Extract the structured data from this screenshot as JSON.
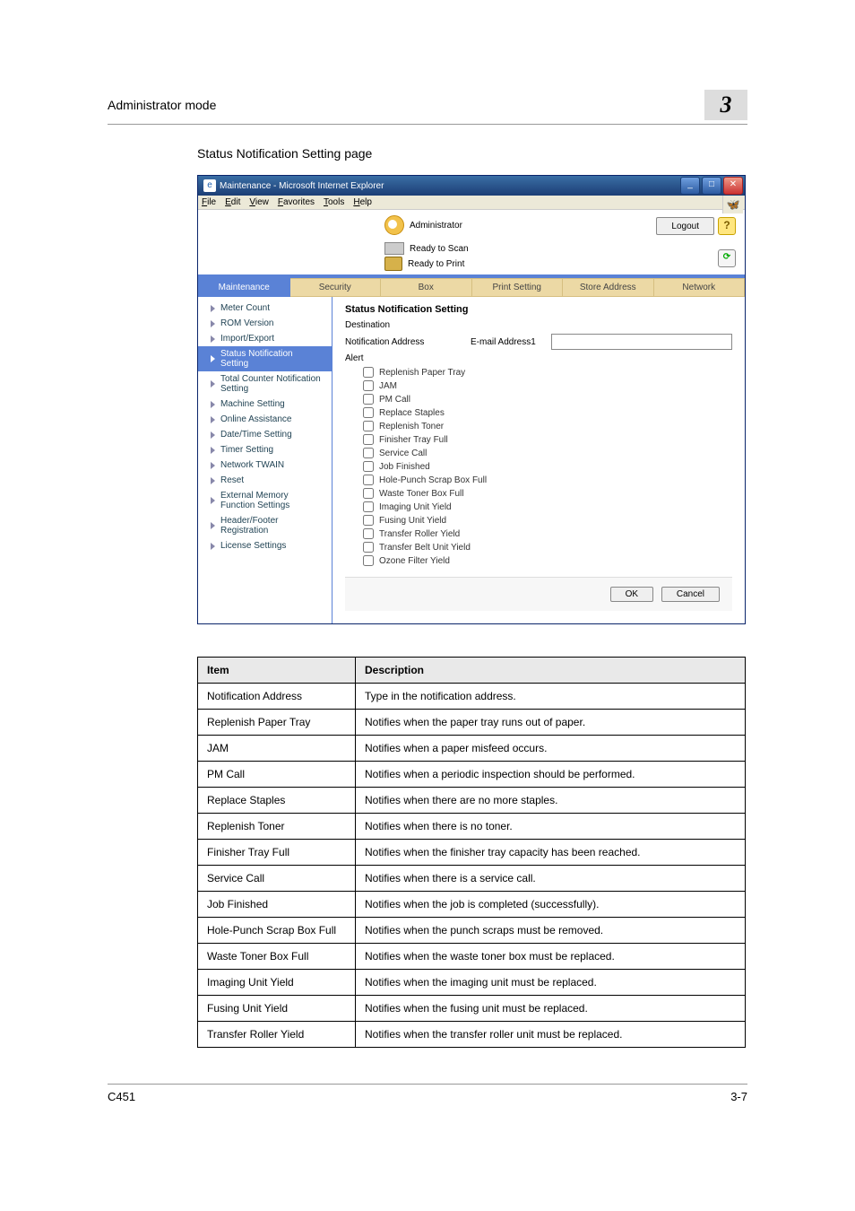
{
  "runner": {
    "title": "Administrator mode",
    "chapter": "3"
  },
  "subheading": "Status Notification Setting page",
  "window": {
    "title": "Maintenance - Microsoft Internet Explorer",
    "menu": [
      "File",
      "Edit",
      "View",
      "Favorites",
      "Tools",
      "Help"
    ],
    "role": "Administrator",
    "ready_scan": "Ready to Scan",
    "ready_print": "Ready to Print",
    "logout": "Logout",
    "tabs": [
      "Maintenance",
      "Security",
      "Box",
      "Print Setting",
      "Store Address",
      "Network"
    ],
    "active_tab": 0,
    "sidebar": [
      "Meter Count",
      "ROM Version",
      "Import/Export",
      "Status Notification Setting",
      "Total Counter Notification Setting",
      "Machine Setting",
      "Online Assistance",
      "Date/Time Setting",
      "Timer Setting",
      "Network TWAIN",
      "Reset",
      "External Memory Function Settings",
      "Header/Footer Registration",
      "License Settings"
    ],
    "active_side": 3,
    "main": {
      "title": "Status Notification Setting",
      "destination_label": "Destination",
      "notif_addr_label": "Notification Address",
      "email_label": "E-mail Address1",
      "alert_label": "Alert",
      "alerts": [
        "Replenish Paper Tray",
        "JAM",
        "PM Call",
        "Replace Staples",
        "Replenish Toner",
        "Finisher Tray Full",
        "Service Call",
        "Job Finished",
        "Hole-Punch Scrap Box Full",
        "Waste Toner Box Full",
        "Imaging Unit Yield",
        "Fusing Unit Yield",
        "Transfer Roller Yield",
        "Transfer Belt Unit Yield",
        "Ozone Filter Yield"
      ],
      "ok": "OK",
      "cancel": "Cancel"
    }
  },
  "table": {
    "headers": [
      "Item",
      "Description"
    ],
    "rows": [
      [
        "Notification Address",
        "Type in the notification address."
      ],
      [
        "Replenish Paper Tray",
        "Notifies when the paper tray runs out of paper."
      ],
      [
        "JAM",
        "Notifies when a paper misfeed occurs."
      ],
      [
        "PM Call",
        "Notifies when a periodic inspection should be performed."
      ],
      [
        "Replace Staples",
        "Notifies when there are no more staples."
      ],
      [
        "Replenish Toner",
        "Notifies when there is no toner."
      ],
      [
        "Finisher Tray Full",
        "Notifies when the finisher tray capacity has been reached."
      ],
      [
        "Service Call",
        "Notifies when there is a service call."
      ],
      [
        "Job Finished",
        "Notifies when the job is completed (successfully)."
      ],
      [
        "Hole-Punch Scrap Box Full",
        "Notifies when the punch scraps must be removed."
      ],
      [
        "Waste Toner Box Full",
        "Notifies when the waste toner box must be replaced."
      ],
      [
        "Imaging Unit Yield",
        "Notifies when the imaging unit must be replaced."
      ],
      [
        "Fusing Unit Yield",
        "Notifies when the fusing unit must be replaced."
      ],
      [
        "Transfer Roller Yield",
        "Notifies when the transfer roller unit must be replaced."
      ]
    ]
  },
  "footer": {
    "left": "C451",
    "right": "3-7"
  }
}
